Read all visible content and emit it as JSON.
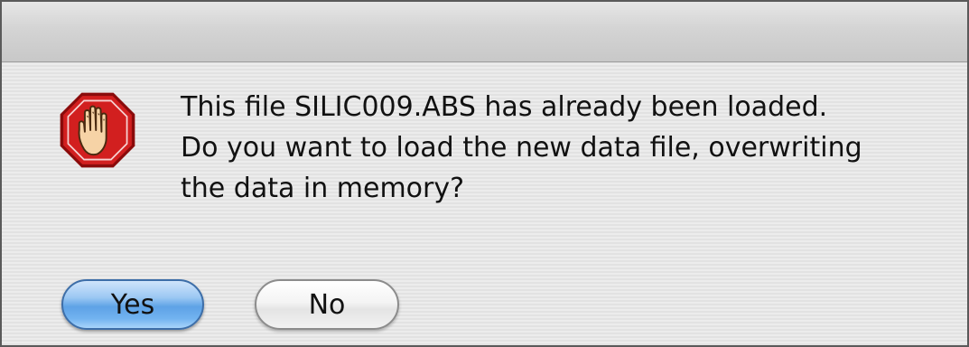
{
  "dialog": {
    "icon": "stop-hand-icon",
    "message_lines": [
      "This file SILIC009.ABS has already been loaded.",
      "Do you want to load the new data file, overwriting",
      "the data in memory?"
    ],
    "buttons": {
      "yes_label": "Yes",
      "no_label": "No"
    }
  },
  "colors": {
    "default_button": "#5ea2e6",
    "stop_sign": "#d21f1f"
  }
}
